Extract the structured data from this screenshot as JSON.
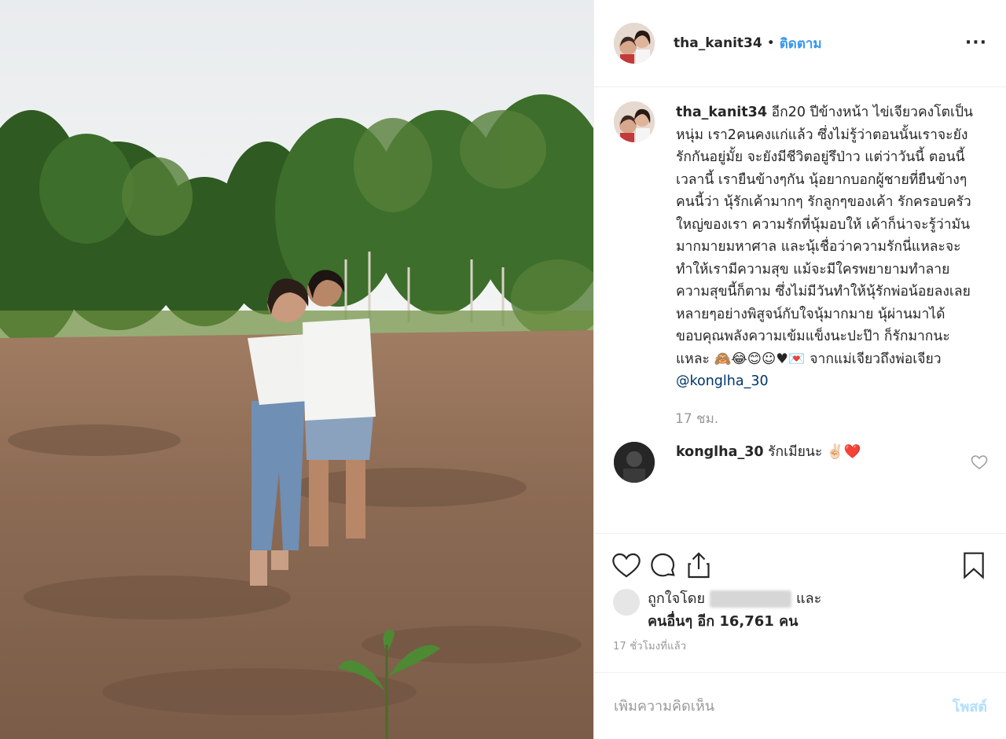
{
  "header": {
    "username": "tha_kanit34",
    "dot": "•",
    "follow_label": "ติดตาม",
    "more_label": "···"
  },
  "caption": {
    "username": "tha_kanit34",
    "text": "อีก20 ปีข้างหน้า ไข่เจียวคงโตเป็นหนุ่ม เรา2คนคงแก่แล้ว ซึ่งไม่รู้ว่าตอนนั้นเราจะยังรักกันอยู่มั้ย จะยังมีชีวิตอยู่รึป่าว แต่ว่าวันนี้ ตอนนี้ เวลานี้ เรายืนข้างๆกัน นุ้อยากบอกผู้ชายที่ยืนข้างๆคนนี้ว่า นุ้รักเค้ามากๆ รักลูกๆของเค้า รักครอบครัวใหญ่ของเรา ความรักที่นุ้มอบให้ เค้าก็น่าจะรู้ว่ามันมากมายมหาศาล และนุ้เชื่อว่าความรักนี่แหละจะทำให้เรามีความสุข แม้จะมีใครพยายามทำลายความสุขนี้ก็ตาม ซึ่งไม่มีวันทำให้นุ้รักพ่อน้อยลงเลย หลายๆอย่างพิสูจน์กับใจนุ้มากมาย นุ้ผ่านมาได้ ขอบคุณพลังความเข้มแข็งนะปะป๊า ก็รักมากนะแหละ 🙈😂😊☺♥💌 จากแม่เจียวถึงพ่อเจียว",
    "mention": "@konglha_30",
    "ago": "17 ชม."
  },
  "comment": {
    "username": "konglha_30",
    "text": "รักเมียนะ ✌🏻❤️"
  },
  "icons": [
    "heart-icon",
    "comment-icon",
    "share-icon",
    "bookmark-icon",
    "more-icon"
  ],
  "likes": {
    "prefix": "ถูกใจโดย",
    "and": "และ",
    "others": "คนอื่นๆ อีก 16,761 คน"
  },
  "timestamp": "17 ชั่วโมงที่แล้ว",
  "add_comment": {
    "placeholder": "เพิ่มความคิดเห็น",
    "post_label": "โพสต์"
  },
  "colors": {
    "link": "#3897f0",
    "mention": "#003569",
    "post_disabled": "#b2dffc",
    "muted": "#999999"
  }
}
